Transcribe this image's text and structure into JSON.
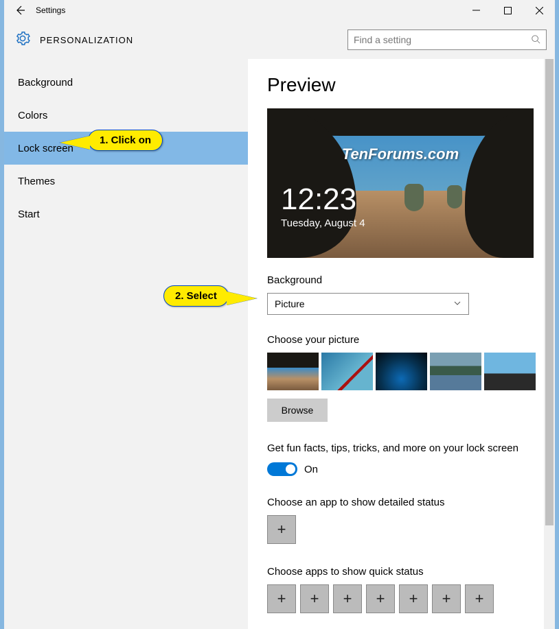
{
  "titlebar": {
    "title": "Settings"
  },
  "header": {
    "title": "PERSONALIZATION",
    "search_placeholder": "Find a setting"
  },
  "sidebar": {
    "items": [
      {
        "label": "Background"
      },
      {
        "label": "Colors"
      },
      {
        "label": "Lock screen"
      },
      {
        "label": "Themes"
      },
      {
        "label": "Start"
      }
    ]
  },
  "main": {
    "preview_heading": "Preview",
    "watermark": "TenForums.com",
    "clock_time": "12:23",
    "clock_date": "Tuesday, August 4",
    "background_label": "Background",
    "background_value": "Picture",
    "choose_picture_label": "Choose your picture",
    "browse_label": "Browse",
    "tips_label": "Get fun facts, tips, tricks, and more on your lock screen",
    "toggle_state": "On",
    "detailed_label": "Choose an app to show detailed status",
    "quick_label": "Choose apps to show quick status",
    "plus_glyph": "+"
  },
  "callouts": {
    "c1": "1. Click on",
    "c2": "2. Select"
  }
}
